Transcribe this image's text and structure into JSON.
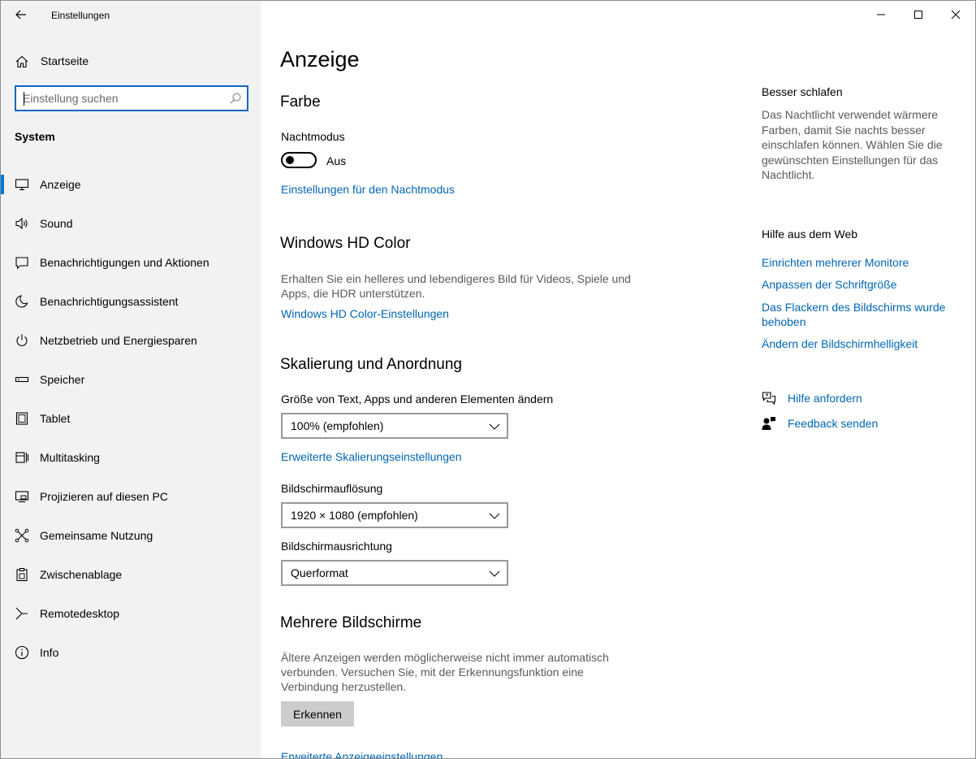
{
  "window": {
    "title": "Einstellungen",
    "icons": {
      "back": "arrow-left-icon",
      "minimize": "minimize-icon",
      "maximize": "maximize-icon",
      "close": "close-icon"
    }
  },
  "sidebar": {
    "home_label": "Startseite",
    "search_placeholder": "Einstellung suchen",
    "section_title": "System",
    "items": [
      {
        "label": "Anzeige",
        "icon": "monitor-icon",
        "active": true
      },
      {
        "label": "Sound",
        "icon": "speaker-icon"
      },
      {
        "label": "Benachrichtigungen und Aktionen",
        "icon": "notification-icon"
      },
      {
        "label": "Benachrichtigungsassistent",
        "icon": "moon-icon"
      },
      {
        "label": "Netzbetrieb und Energiesparen",
        "icon": "power-icon"
      },
      {
        "label": "Speicher",
        "icon": "storage-icon"
      },
      {
        "label": "Tablet",
        "icon": "tablet-icon"
      },
      {
        "label": "Multitasking",
        "icon": "multitasking-icon"
      },
      {
        "label": "Projizieren auf diesen PC",
        "icon": "project-icon"
      },
      {
        "label": "Gemeinsame Nutzung",
        "icon": "share-icon"
      },
      {
        "label": "Zwischenablage",
        "icon": "clipboard-icon"
      },
      {
        "label": "Remotedesktop",
        "icon": "remote-desktop-icon"
      },
      {
        "label": "Info",
        "icon": "info-icon"
      }
    ]
  },
  "main": {
    "title": "Anzeige",
    "farbe": {
      "heading": "Farbe",
      "night_mode_label": "Nachtmodus",
      "night_mode_state": "Aus",
      "night_mode_on": false,
      "settings_link": "Einstellungen für den Nachtmodus"
    },
    "hd_color": {
      "heading": "Windows HD Color",
      "description": "Erhalten Sie ein helleres und lebendigeres Bild für Videos, Spiele und Apps, die HDR unterstützen.",
      "link": "Windows HD Color-Einstellungen"
    },
    "scaling": {
      "heading": "Skalierung und Anordnung",
      "size_label": "Größe von Text, Apps und anderen Elementen ändern",
      "size_value": "100% (empfohlen)",
      "advanced_link": "Erweiterte Skalierungseinstellungen",
      "resolution_label": "Bildschirmauflösung",
      "resolution_value": "1920 × 1080 (empfohlen)",
      "orientation_label": "Bildschirmausrichtung",
      "orientation_value": "Querformat"
    },
    "multi": {
      "heading": "Mehrere Bildschirme",
      "description": "Ältere Anzeigen werden möglicherweise nicht immer automatisch verbunden. Versuchen Sie, mit der Erkennungsfunktion eine Verbindung herzustellen.",
      "detect_button": "Erkennen",
      "advanced_link": "Erweiterte Anzeigeeinstellungen"
    }
  },
  "aside": {
    "sleep_heading": "Besser schlafen",
    "sleep_description": "Das Nachtlicht verwendet wärmere Farben, damit Sie nachts besser einschlafen können. Wählen Sie die gewünschten Einstellungen für das Nachtlicht.",
    "web_help_heading": "Hilfe aus dem Web",
    "web_links": [
      "Einrichten mehrerer Monitore",
      "Anpassen der Schriftgröße",
      "Das Flackern des Bildschirms wurde behoben",
      "Ändern der Bildschirmhelligkeit"
    ],
    "get_help": "Hilfe anfordern",
    "send_feedback": "Feedback senden"
  },
  "colors": {
    "accent": "#0078d7",
    "link": "#0066b4",
    "sidebar_bg": "#f2f2f2"
  }
}
